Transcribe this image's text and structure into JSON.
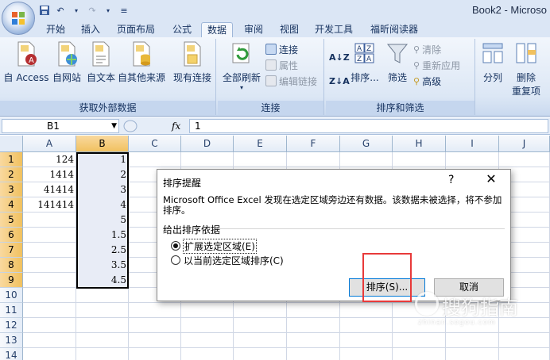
{
  "window": {
    "title": "Book2 - Microso"
  },
  "tabs": [
    "开始",
    "插入",
    "页面布局",
    "公式",
    "数据",
    "审阅",
    "视图",
    "开发工具",
    "福昕阅读器"
  ],
  "active_tab": "数据",
  "ribbon": {
    "external_data": {
      "label": "获取外部数据",
      "buttons": [
        "自 Access",
        "自网站",
        "自文本",
        "自其他来源",
        "现有连接"
      ]
    },
    "connections": {
      "label": "连接",
      "refresh_all": "全部刷新",
      "connections": "连接",
      "properties": "属性",
      "edit_links": "编辑链接"
    },
    "sort_filter": {
      "label": "排序和筛选",
      "sort": "排序...",
      "filter": "筛选",
      "clear": "清除",
      "reapply": "重新应用",
      "advanced": "高级"
    },
    "data_tools": {
      "split": "分列",
      "remove_dup": "删除",
      "remove_dup_line2": "重复项"
    }
  },
  "formula_bar": {
    "name_box": "B1",
    "fx": "fx",
    "value": "1"
  },
  "sheet": {
    "columns": [
      "A",
      "B",
      "C",
      "D",
      "E",
      "F",
      "G",
      "H",
      "I",
      "J"
    ],
    "rows": [
      "1",
      "2",
      "3",
      "4",
      "5",
      "6",
      "7",
      "8",
      "9",
      "10",
      "11",
      "12",
      "13",
      "14"
    ],
    "column_a": [
      "124",
      "1414",
      "41414",
      "141414"
    ],
    "column_b": [
      "1",
      "2",
      "3",
      "4",
      "5",
      "1.5",
      "2.5",
      "3.5",
      "4.5"
    ]
  },
  "dialog": {
    "title": "排序提醒",
    "help": "?",
    "close": "✕",
    "message": "Microsoft Office Excel 发现在选定区域旁边还有数据。该数据未被选择，将不参加排序。",
    "group_label": "给出排序依据",
    "option_expand": "扩展选定区域(E)",
    "option_current": "以当前选定区域排序(C)",
    "sort_button": "排序(S)...",
    "cancel_button": "取消"
  },
  "watermark": {
    "text": "搜狗指南",
    "sub": "zhinan.sogou.com"
  },
  "colors": {
    "accent_red": "#e83a3a",
    "selection_header": "#f1c15f",
    "ribbon_blue": "#dbe6f5"
  }
}
